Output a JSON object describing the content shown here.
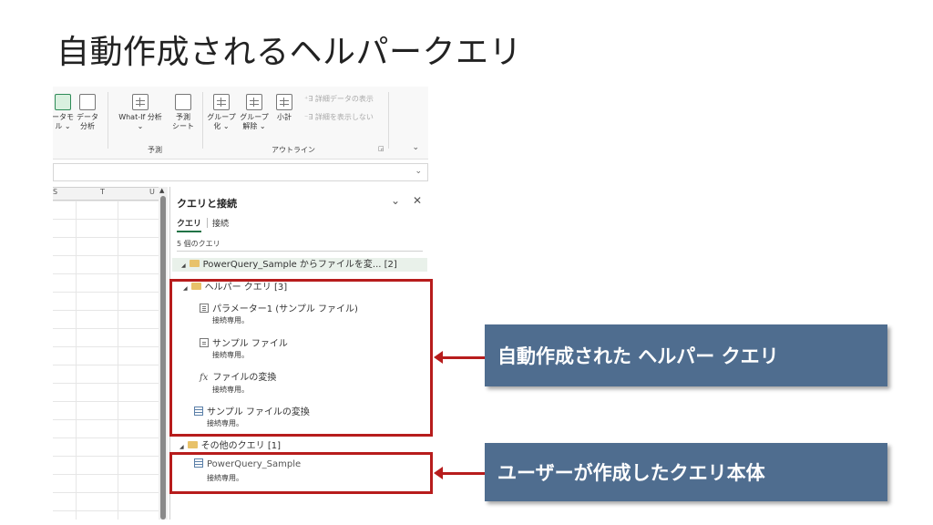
{
  "slide": {
    "title": "自動作成されるヘルパークエリ"
  },
  "ribbon": {
    "btn_data_model_1": "ータモ",
    "btn_data_model_2": "ル ⌄",
    "btn_data_analysis_1": "データ",
    "btn_data_analysis_2": "分析",
    "btn_whatif_1": "What-If 分析",
    "btn_whatif_2": "⌄",
    "btn_forecast_1": "予測",
    "btn_forecast_2": "シート",
    "group_forecast": "予測",
    "btn_group_1": "グループ",
    "btn_group_2": "化 ⌄",
    "btn_ungroup_1": "グループ",
    "btn_ungroup_2": "解除 ⌄",
    "btn_subtotal": "小計",
    "show_detail": "詳細データの表示",
    "hide_detail": "詳細を表示しない",
    "group_outline": "アウトライン",
    "collapse_icon": "chevron-down-icon"
  },
  "sheet": {
    "columns": [
      "S",
      "T",
      "U"
    ]
  },
  "pane": {
    "title": "クエリと接続",
    "tabs": [
      "クエリ",
      "接続"
    ],
    "count": "5 個のクエリ",
    "groups": [
      {
        "label": "PowerQuery_Sample からファイルを変...",
        "count": "[2]"
      },
      {
        "label": "ヘルパー クエリ",
        "count": "[3]"
      },
      {
        "label": "その他のクエリ",
        "count": "[1]"
      }
    ],
    "queries": [
      {
        "name": "パラメーター1 (サンプル ファイル)",
        "sub": "接続専用。",
        "icon": "parameter-icon"
      },
      {
        "name": "サンプル ファイル",
        "sub": "接続専用。",
        "icon": "file-icon"
      },
      {
        "name": "ファイルの変換",
        "sub": "接続専用。",
        "icon": "function-icon"
      },
      {
        "name": "サンプル ファイルの変換",
        "sub": "接続専用。",
        "icon": "table-icon"
      },
      {
        "name": "PowerQuery_Sample",
        "sub": "接続専用。",
        "icon": "table-icon"
      }
    ]
  },
  "callouts": {
    "helper": "自動作成された ヘルパー クエリ",
    "user": "ユーザーが作成したクエリ本体"
  },
  "colors": {
    "callout_bg": "#4f6d8f",
    "highlight_red": "#b71c1c",
    "excel_green": "#217346"
  }
}
